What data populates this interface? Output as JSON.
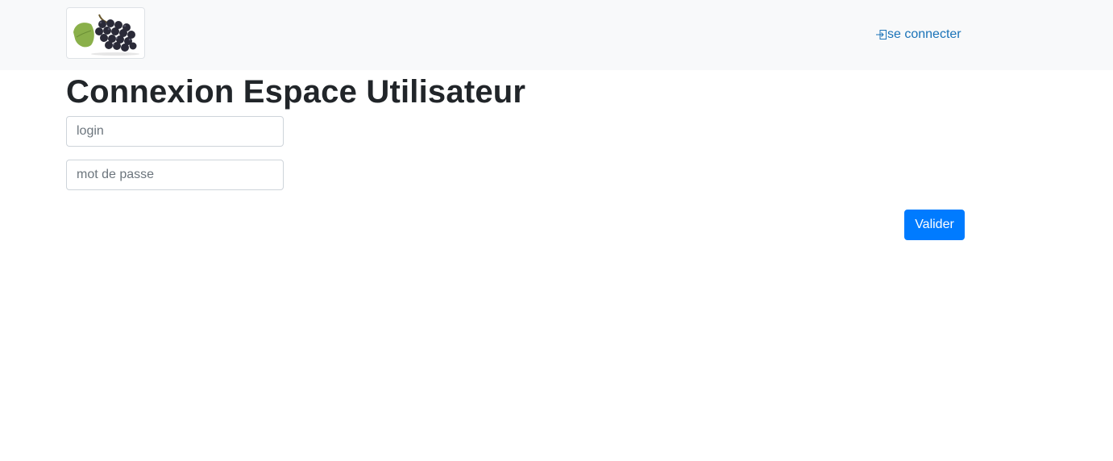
{
  "header": {
    "logo_icon": "grapes-logo-icon",
    "login_link_label": "se connecter",
    "login_link_icon": "sign-in-icon",
    "link_color": "#1a73b8"
  },
  "main": {
    "title": "Connexion Espace Utilisateur",
    "login_field": {
      "placeholder": "login",
      "value": ""
    },
    "password_field": {
      "placeholder": "mot de passe",
      "value": ""
    },
    "submit_label": "Valider",
    "submit_color": "#007bff"
  }
}
